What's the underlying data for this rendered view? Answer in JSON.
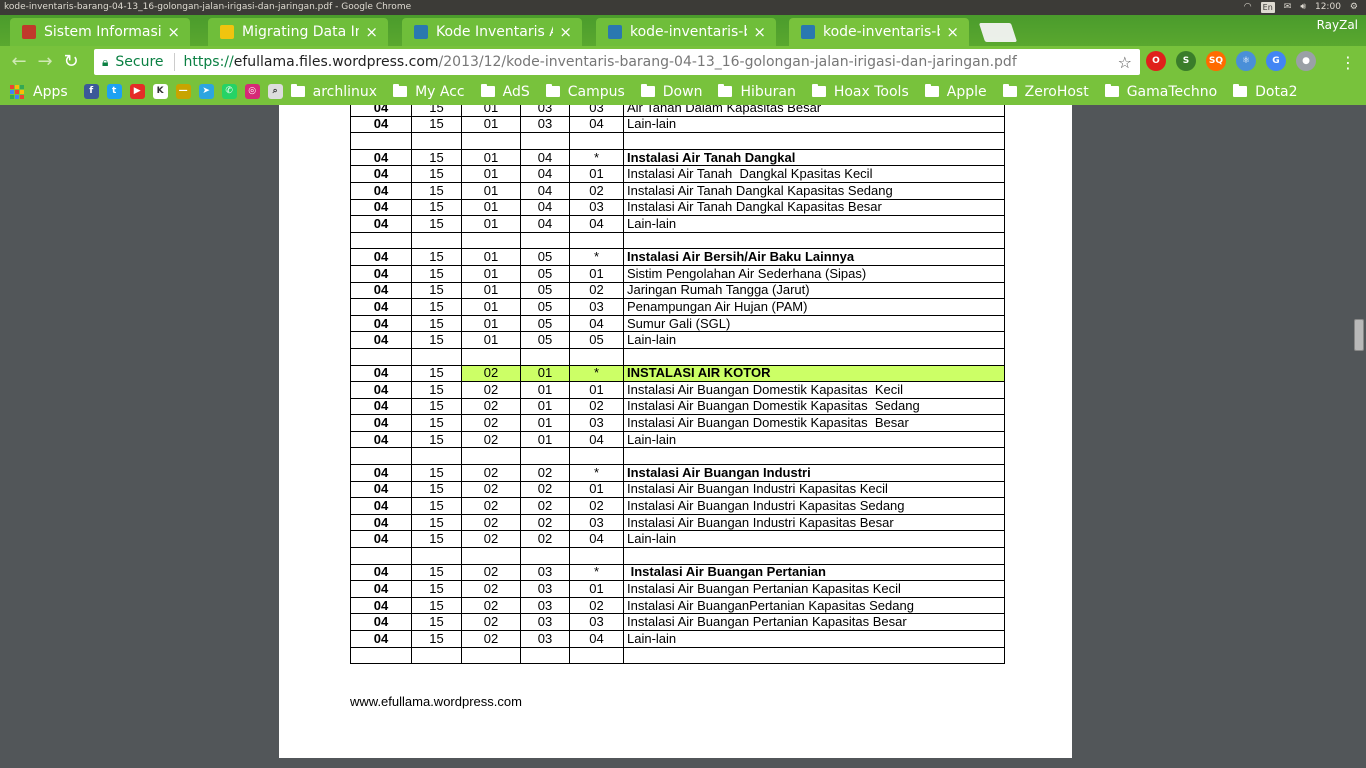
{
  "os": {
    "window_title": "kode-inventaris-barang-04-13_16-golongan-jalan-irigasi-dan-jaringan.pdf - Google Chrome",
    "lang": "En",
    "time": "12:00"
  },
  "browser": {
    "tabs": [
      {
        "label": "Sistem Informasi A",
        "favicon_color": "#c0392b"
      },
      {
        "label": "Migrating Data Into",
        "favicon_color": "#f1c40f"
      },
      {
        "label": "Kode Inventaris As",
        "favicon_color": "#2a78b0"
      },
      {
        "label": "kode-inventaris-ba",
        "favicon_color": "#2a78b0"
      },
      {
        "label": "kode-inventaris-ba",
        "favicon_color": "#2a78b0"
      }
    ],
    "profile": "RayZal",
    "secure_label": "Secure",
    "url_scheme": "https://",
    "url_host": "efullama.files.wordpress.com",
    "url_path": "/2013/12/kode-inventaris-barang-04-13_16-golongan-jalan-irigasi-dan-jaringan.pdf",
    "bookmarks": [
      {
        "label": "Apps",
        "type": "apps"
      },
      {
        "label": "",
        "type": "icon",
        "color": "#3b5998",
        "glyph": "f"
      },
      {
        "label": "",
        "type": "icon",
        "color": "#1da1f2",
        "glyph": "t"
      },
      {
        "label": "",
        "type": "icon",
        "color": "#e52d27",
        "glyph": "▶"
      },
      {
        "label": "",
        "type": "icon",
        "color": "#ffffff",
        "glyph": "K"
      },
      {
        "label": "",
        "type": "icon",
        "color": "#c8a400",
        "glyph": "—"
      },
      {
        "label": "",
        "type": "icon",
        "color": "#2ca5e0",
        "glyph": "➤"
      },
      {
        "label": "",
        "type": "icon",
        "color": "#25d366",
        "glyph": "✆"
      },
      {
        "label": "",
        "type": "icon",
        "color": "#d62976",
        "glyph": "◎"
      },
      {
        "label": "",
        "type": "icon",
        "color": "#dddddd",
        "glyph": "⌕"
      },
      {
        "label": "archlinux",
        "type": "folder"
      },
      {
        "label": "My Acc",
        "type": "folder"
      },
      {
        "label": "AdS",
        "type": "folder"
      },
      {
        "label": "Campus",
        "type": "folder"
      },
      {
        "label": "Down",
        "type": "folder"
      },
      {
        "label": "Hiburan",
        "type": "folder"
      },
      {
        "label": "Hoax Tools",
        "type": "folder"
      },
      {
        "label": "Apple",
        "type": "folder"
      },
      {
        "label": "ZeroHost",
        "type": "folder"
      },
      {
        "label": "GamaTechno",
        "type": "folder"
      },
      {
        "label": "Dota2",
        "type": "folder"
      }
    ],
    "extensions": [
      {
        "name": "opera-icon",
        "color": "#e0201b",
        "glyph": "O"
      },
      {
        "name": "seo-icon",
        "color": "#3a7d2a",
        "glyph": "S"
      },
      {
        "name": "sq-icon",
        "color": "#ff6a00",
        "glyph": "SQ"
      },
      {
        "name": "react-icon",
        "color": "#4a8fd8",
        "glyph": "⚛"
      },
      {
        "name": "translate-icon",
        "color": "#4285f4",
        "glyph": "G"
      },
      {
        "name": "record-icon",
        "color": "#9aa0a6",
        "glyph": "●"
      }
    ]
  },
  "pdf": {
    "rows": [
      [
        "04",
        "15",
        "01",
        "03",
        "03",
        "Air Tanah Dalam Kapasitas Besar",
        "normal"
      ],
      [
        "04",
        "15",
        "01",
        "03",
        "04",
        "Lain-lain",
        "normal"
      ],
      [
        "",
        "",
        "",
        "",
        "",
        "",
        "blank"
      ],
      [
        "04",
        "15",
        "01",
        "04",
        "*",
        "Instalasi Air Tanah Dangkal",
        "bold"
      ],
      [
        "04",
        "15",
        "01",
        "04",
        "01",
        "Instalasi Air Tanah  Dangkal Kpasitas Kecil",
        "normal"
      ],
      [
        "04",
        "15",
        "01",
        "04",
        "02",
        "Instalasi Air Tanah Dangkal Kapasitas Sedang",
        "normal"
      ],
      [
        "04",
        "15",
        "01",
        "04",
        "03",
        "Instalasi Air Tanah Dangkal Kapasitas Besar",
        "normal"
      ],
      [
        "04",
        "15",
        "01",
        "04",
        "04",
        "Lain-lain",
        "normal"
      ],
      [
        "",
        "",
        "",
        "",
        "",
        "",
        "blank"
      ],
      [
        "04",
        "15",
        "01",
        "05",
        "*",
        "Instalasi Air Bersih/Air Baku Lainnya",
        "bold"
      ],
      [
        "04",
        "15",
        "01",
        "05",
        "01",
        "Sistim Pengolahan Air Sederhana (Sipas)",
        "normal"
      ],
      [
        "04",
        "15",
        "01",
        "05",
        "02",
        "Jaringan Rumah Tangga (Jarut)",
        "normal"
      ],
      [
        "04",
        "15",
        "01",
        "05",
        "03",
        "Penampungan Air Hujan (PAM)",
        "normal"
      ],
      [
        "04",
        "15",
        "01",
        "05",
        "04",
        "Sumur Gali (SGL)",
        "normal"
      ],
      [
        "04",
        "15",
        "01",
        "05",
        "05",
        "Lain-lain",
        "normal"
      ],
      [
        "",
        "",
        "",
        "",
        "",
        "",
        "blank"
      ],
      [
        "04",
        "15",
        "02",
        "01",
        "*",
        "INSTALASI AIR KOTOR",
        "highlight"
      ],
      [
        "04",
        "15",
        "02",
        "01",
        "01",
        "Instalasi Air Buangan Domestik Kapasitas  Kecil",
        "normal"
      ],
      [
        "04",
        "15",
        "02",
        "01",
        "02",
        "Instalasi Air Buangan Domestik Kapasitas  Sedang",
        "normal"
      ],
      [
        "04",
        "15",
        "02",
        "01",
        "03",
        "Instalasi Air Buangan Domestik Kapasitas  Besar",
        "normal"
      ],
      [
        "04",
        "15",
        "02",
        "01",
        "04",
        "Lain-lain",
        "normal"
      ],
      [
        "",
        "",
        "",
        "",
        "",
        "",
        "blank"
      ],
      [
        "04",
        "15",
        "02",
        "02",
        "*",
        "Instalasi Air Buangan Industri",
        "bold"
      ],
      [
        "04",
        "15",
        "02",
        "02",
        "01",
        "Instalasi Air Buangan Industri Kapasitas Kecil",
        "normal"
      ],
      [
        "04",
        "15",
        "02",
        "02",
        "02",
        "Instalasi Air Buangan Industri Kapasitas Sedang",
        "normal"
      ],
      [
        "04",
        "15",
        "02",
        "02",
        "03",
        "Instalasi Air Buangan Industri Kapasitas Besar",
        "normal"
      ],
      [
        "04",
        "15",
        "02",
        "02",
        "04",
        "Lain-lain",
        "normal"
      ],
      [
        "",
        "",
        "",
        "",
        "",
        "",
        "blank"
      ],
      [
        "04",
        "15",
        "02",
        "03",
        "*",
        " Instalasi Air Buangan Pertanian",
        "bold"
      ],
      [
        "04",
        "15",
        "02",
        "03",
        "01",
        "Instalasi Air Buangan Pertanian Kapasitas Kecil",
        "normal"
      ],
      [
        "04",
        "15",
        "02",
        "03",
        "02",
        "Instalasi Air BuanganPertanian Kapasitas Sedang",
        "normal"
      ],
      [
        "04",
        "15",
        "02",
        "03",
        "03",
        "Instalasi Air Buangan Pertanian Kapasitas Besar",
        "normal"
      ],
      [
        "04",
        "15",
        "02",
        "03",
        "04",
        "Lain-lain",
        "normal"
      ],
      [
        "",
        "",
        "",
        "",
        "",
        "",
        "last"
      ]
    ],
    "footer_url": "www.efullama.wordpress.com"
  }
}
